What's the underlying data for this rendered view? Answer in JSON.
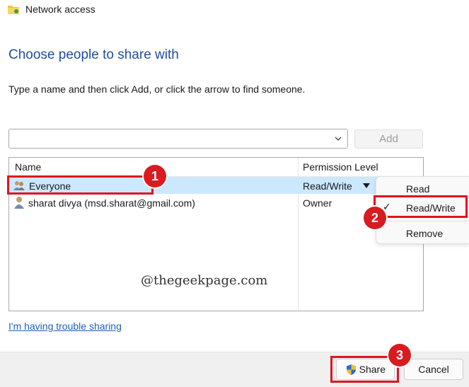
{
  "window": {
    "title": "Network access",
    "icon": "shared-folder-icon"
  },
  "main": {
    "heading": "Choose people to share with",
    "instruction": "Type a name and then click Add, or click the arrow to find someone.",
    "name_input": {
      "value": "",
      "placeholder": ""
    },
    "add_label": "Add"
  },
  "table": {
    "columns": [
      "Name",
      "Permission Level"
    ],
    "rows": [
      {
        "name": "Everyone",
        "permission": "Read/Write",
        "icon": "group-users-icon",
        "selected": true
      },
      {
        "name": "sharat divya (msd.sharat@gmail.com)",
        "permission": "Owner",
        "icon": "user-icon",
        "selected": false
      }
    ]
  },
  "permission_menu": {
    "items": [
      "Read",
      "Read/Write",
      "Remove"
    ],
    "checked": "Read/Write",
    "check_glyph": "✓"
  },
  "watermark": "@thegeekpage.com",
  "trouble_link": "I'm having trouble sharing",
  "footer": {
    "share_label": "Share",
    "cancel_label": "Cancel",
    "share_icon": "uac-shield-icon"
  },
  "annotations": {
    "badges": [
      "1",
      "2",
      "3"
    ],
    "color": "#d81b20"
  },
  "colors": {
    "heading": "#1f4e9b",
    "selection": "#cce8ff",
    "link": "#1f5fb8"
  }
}
